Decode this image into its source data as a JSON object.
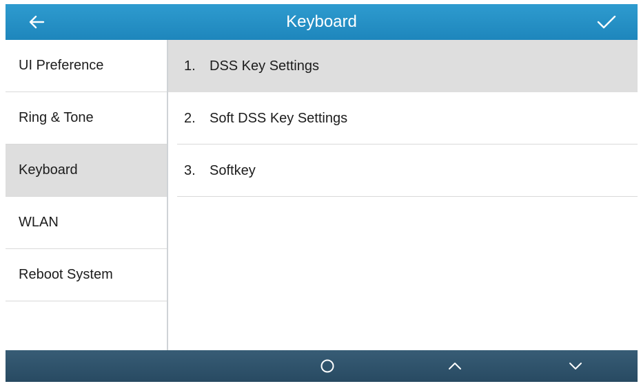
{
  "header": {
    "title": "Keyboard",
    "back_icon": "arrow-left-icon",
    "confirm_icon": "checkmark-icon"
  },
  "sidebar": {
    "items": [
      {
        "label": "UI Preference"
      },
      {
        "label": "Ring & Tone"
      },
      {
        "label": "Keyboard",
        "selected": true
      },
      {
        "label": "WLAN"
      },
      {
        "label": "Reboot System"
      }
    ]
  },
  "menu": {
    "items": [
      {
        "number": "1.",
        "label": "DSS Key Settings",
        "selected": true
      },
      {
        "number": "2.",
        "label": "Soft DSS Key Settings"
      },
      {
        "number": "3.",
        "label": "Softkey"
      }
    ]
  },
  "softkeys": {
    "items": [
      {
        "icon": ""
      },
      {
        "icon": ""
      },
      {
        "icon": "circle-icon"
      },
      {
        "icon": "chevron-up-icon"
      },
      {
        "icon": "chevron-down-icon"
      }
    ]
  },
  "colors": {
    "header": "#1e86bc",
    "footer": "#284a62",
    "selected_row": "#dedede",
    "text": "#1c1c1c"
  }
}
